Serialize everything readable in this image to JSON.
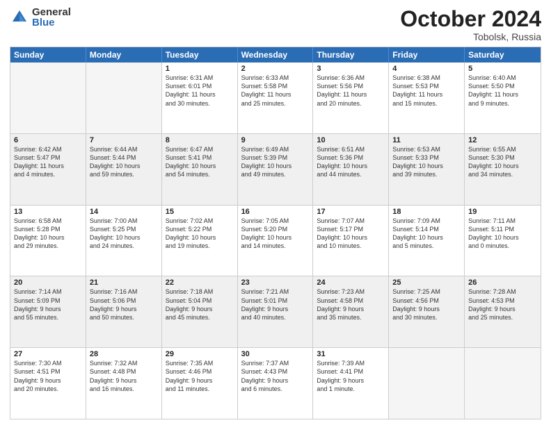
{
  "logo": {
    "general": "General",
    "blue": "Blue"
  },
  "title": "October 2024",
  "subtitle": "Tobolsk, Russia",
  "days": [
    "Sunday",
    "Monday",
    "Tuesday",
    "Wednesday",
    "Thursday",
    "Friday",
    "Saturday"
  ],
  "weeks": [
    [
      {
        "day": "",
        "sunrise": "",
        "sunset": "",
        "daylight": "",
        "empty": true
      },
      {
        "day": "",
        "sunrise": "",
        "sunset": "",
        "daylight": "",
        "empty": true
      },
      {
        "day": "1",
        "sunrise": "Sunrise: 6:31 AM",
        "sunset": "Sunset: 6:01 PM",
        "daylight": "Daylight: 11 hours and 30 minutes."
      },
      {
        "day": "2",
        "sunrise": "Sunrise: 6:33 AM",
        "sunset": "Sunset: 5:58 PM",
        "daylight": "Daylight: 11 hours and 25 minutes."
      },
      {
        "day": "3",
        "sunrise": "Sunrise: 6:36 AM",
        "sunset": "Sunset: 5:56 PM",
        "daylight": "Daylight: 11 hours and 20 minutes."
      },
      {
        "day": "4",
        "sunrise": "Sunrise: 6:38 AM",
        "sunset": "Sunset: 5:53 PM",
        "daylight": "Daylight: 11 hours and 15 minutes."
      },
      {
        "day": "5",
        "sunrise": "Sunrise: 6:40 AM",
        "sunset": "Sunset: 5:50 PM",
        "daylight": "Daylight: 11 hours and 9 minutes."
      }
    ],
    [
      {
        "day": "6",
        "sunrise": "Sunrise: 6:42 AM",
        "sunset": "Sunset: 5:47 PM",
        "daylight": "Daylight: 11 hours and 4 minutes."
      },
      {
        "day": "7",
        "sunrise": "Sunrise: 6:44 AM",
        "sunset": "Sunset: 5:44 PM",
        "daylight": "Daylight: 10 hours and 59 minutes."
      },
      {
        "day": "8",
        "sunrise": "Sunrise: 6:47 AM",
        "sunset": "Sunset: 5:41 PM",
        "daylight": "Daylight: 10 hours and 54 minutes."
      },
      {
        "day": "9",
        "sunrise": "Sunrise: 6:49 AM",
        "sunset": "Sunset: 5:39 PM",
        "daylight": "Daylight: 10 hours and 49 minutes."
      },
      {
        "day": "10",
        "sunrise": "Sunrise: 6:51 AM",
        "sunset": "Sunset: 5:36 PM",
        "daylight": "Daylight: 10 hours and 44 minutes."
      },
      {
        "day": "11",
        "sunrise": "Sunrise: 6:53 AM",
        "sunset": "Sunset: 5:33 PM",
        "daylight": "Daylight: 10 hours and 39 minutes."
      },
      {
        "day": "12",
        "sunrise": "Sunrise: 6:55 AM",
        "sunset": "Sunset: 5:30 PM",
        "daylight": "Daylight: 10 hours and 34 minutes."
      }
    ],
    [
      {
        "day": "13",
        "sunrise": "Sunrise: 6:58 AM",
        "sunset": "Sunset: 5:28 PM",
        "daylight": "Daylight: 10 hours and 29 minutes."
      },
      {
        "day": "14",
        "sunrise": "Sunrise: 7:00 AM",
        "sunset": "Sunset: 5:25 PM",
        "daylight": "Daylight: 10 hours and 24 minutes."
      },
      {
        "day": "15",
        "sunrise": "Sunrise: 7:02 AM",
        "sunset": "Sunset: 5:22 PM",
        "daylight": "Daylight: 10 hours and 19 minutes."
      },
      {
        "day": "16",
        "sunrise": "Sunrise: 7:05 AM",
        "sunset": "Sunset: 5:20 PM",
        "daylight": "Daylight: 10 hours and 14 minutes."
      },
      {
        "day": "17",
        "sunrise": "Sunrise: 7:07 AM",
        "sunset": "Sunset: 5:17 PM",
        "daylight": "Daylight: 10 hours and 10 minutes."
      },
      {
        "day": "18",
        "sunrise": "Sunrise: 7:09 AM",
        "sunset": "Sunset: 5:14 PM",
        "daylight": "Daylight: 10 hours and 5 minutes."
      },
      {
        "day": "19",
        "sunrise": "Sunrise: 7:11 AM",
        "sunset": "Sunset: 5:11 PM",
        "daylight": "Daylight: 10 hours and 0 minutes."
      }
    ],
    [
      {
        "day": "20",
        "sunrise": "Sunrise: 7:14 AM",
        "sunset": "Sunset: 5:09 PM",
        "daylight": "Daylight: 9 hours and 55 minutes."
      },
      {
        "day": "21",
        "sunrise": "Sunrise: 7:16 AM",
        "sunset": "Sunset: 5:06 PM",
        "daylight": "Daylight: 9 hours and 50 minutes."
      },
      {
        "day": "22",
        "sunrise": "Sunrise: 7:18 AM",
        "sunset": "Sunset: 5:04 PM",
        "daylight": "Daylight: 9 hours and 45 minutes."
      },
      {
        "day": "23",
        "sunrise": "Sunrise: 7:21 AM",
        "sunset": "Sunset: 5:01 PM",
        "daylight": "Daylight: 9 hours and 40 minutes."
      },
      {
        "day": "24",
        "sunrise": "Sunrise: 7:23 AM",
        "sunset": "Sunset: 4:58 PM",
        "daylight": "Daylight: 9 hours and 35 minutes."
      },
      {
        "day": "25",
        "sunrise": "Sunrise: 7:25 AM",
        "sunset": "Sunset: 4:56 PM",
        "daylight": "Daylight: 9 hours and 30 minutes."
      },
      {
        "day": "26",
        "sunrise": "Sunrise: 7:28 AM",
        "sunset": "Sunset: 4:53 PM",
        "daylight": "Daylight: 9 hours and 25 minutes."
      }
    ],
    [
      {
        "day": "27",
        "sunrise": "Sunrise: 7:30 AM",
        "sunset": "Sunset: 4:51 PM",
        "daylight": "Daylight: 9 hours and 20 minutes."
      },
      {
        "day": "28",
        "sunrise": "Sunrise: 7:32 AM",
        "sunset": "Sunset: 4:48 PM",
        "daylight": "Daylight: 9 hours and 16 minutes."
      },
      {
        "day": "29",
        "sunrise": "Sunrise: 7:35 AM",
        "sunset": "Sunset: 4:46 PM",
        "daylight": "Daylight: 9 hours and 11 minutes."
      },
      {
        "day": "30",
        "sunrise": "Sunrise: 7:37 AM",
        "sunset": "Sunset: 4:43 PM",
        "daylight": "Daylight: 9 hours and 6 minutes."
      },
      {
        "day": "31",
        "sunrise": "Sunrise: 7:39 AM",
        "sunset": "Sunset: 4:41 PM",
        "daylight": "Daylight: 9 hours and 1 minute."
      },
      {
        "day": "",
        "sunrise": "",
        "sunset": "",
        "daylight": "",
        "empty": true
      },
      {
        "day": "",
        "sunrise": "",
        "sunset": "",
        "daylight": "",
        "empty": true
      }
    ]
  ]
}
